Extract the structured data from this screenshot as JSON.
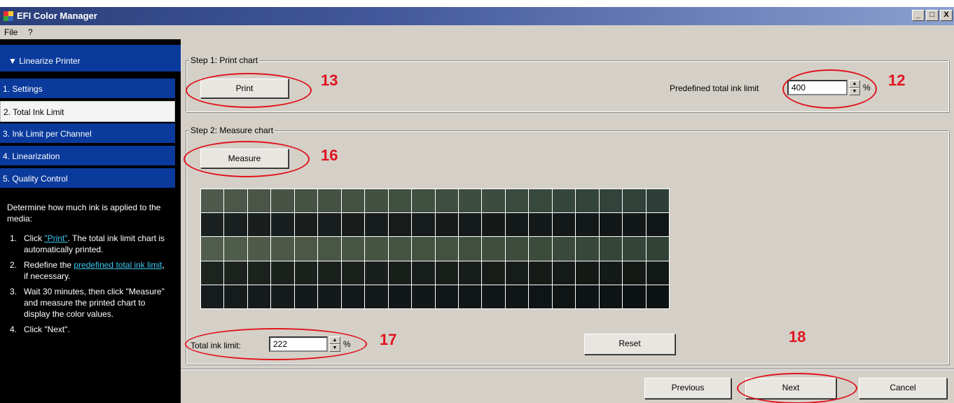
{
  "window": {
    "title": "EFI Color Manager",
    "minimize": "_",
    "maximize": "□",
    "close": "X"
  },
  "menu": [
    "File",
    "?"
  ],
  "sidebar": {
    "header": "Linearize Printer",
    "items": [
      {
        "label": "1. Settings"
      },
      {
        "label": "2. Total Ink Limit"
      },
      {
        "label": "3. Ink Limit per Channel"
      },
      {
        "label": "4. Linearization"
      },
      {
        "label": "5. Quality Control"
      }
    ],
    "help": {
      "intro": "Determine how much ink is applied to the media:",
      "steps": [
        {
          "num": "1.",
          "link": "\"Print\"",
          "text": ". The total ink limit chart is automatically printed.",
          "prefix": "Click "
        },
        {
          "num": "2.",
          "prefix": "Redefine the ",
          "link": "predefined total ink limit",
          "text": ", if necessary."
        },
        {
          "num": "3.",
          "text": "Wait 30 minutes, then click \"Measure\" and measure the printed chart to display the color values."
        },
        {
          "num": "4.",
          "text": "Click \"Next\"."
        }
      ]
    }
  },
  "step1": {
    "label": "Step 1: Print chart",
    "print_button": "Print",
    "ink_limit_label": "Predefined total ink limit",
    "ink_limit_value": "400",
    "unit": "%"
  },
  "step2": {
    "label": "Step 2: Measure chart",
    "measure_button": "Measure",
    "total_ink_label": "Total ink limit:",
    "total_ink_value": "222",
    "unit": "%",
    "reset_button": "Reset",
    "swatch_rows": [
      [
        "#4f5a4d",
        "#4c5749",
        "#4a5447",
        "#485345",
        "#465243",
        "#455243",
        "#445142",
        "#425041",
        "#405040",
        "#3f4f40",
        "#3e4e40",
        "#3d4d40",
        "#3b4b3f",
        "#394a3e",
        "#37483d",
        "#35463c",
        "#33443b",
        "#31433a",
        "#2f4139",
        "#2d3f38"
      ],
      [
        "#1b2120",
        "#1a201f",
        "#1a1f1e",
        "#191f1e",
        "#191e1d",
        "#181e1d",
        "#181d1c",
        "#171d1c",
        "#171c1b",
        "#161c1b",
        "#161b1a",
        "#151b1a",
        "#151a19",
        "#141a19",
        "#141919",
        "#131918",
        "#131818",
        "#121817",
        "#121717",
        "#111716"
      ],
      [
        "#525e4d",
        "#505c4a",
        "#4f5b48",
        "#4d5946",
        "#4c5845",
        "#4a5644",
        "#485543",
        "#475442",
        "#455341",
        "#445240",
        "#43513f",
        "#41503e",
        "#3f4e3e",
        "#3d4c3d",
        "#3b4b3c",
        "#39493b",
        "#37483a",
        "#354639",
        "#334438",
        "#314237"
      ],
      [
        "#1d2420",
        "#1c231f",
        "#1c221e",
        "#1b221e",
        "#1b211d",
        "#1a211d",
        "#1a201c",
        "#191f1c",
        "#191f1b",
        "#181e1b",
        "#181e1a",
        "#171d1a",
        "#171c19",
        "#161c19",
        "#161b18",
        "#151b18",
        "#151a17",
        "#141a17",
        "#141916",
        "#131916"
      ],
      [
        "#161c1d",
        "#161b1c",
        "#151b1c",
        "#151a1b",
        "#141a1b",
        "#14191a",
        "#13191a",
        "#131819",
        "#121819",
        "#121718",
        "#111718",
        "#111617",
        "#101617",
        "#101516",
        "#0f1516",
        "#0f1415",
        "#0e1415",
        "#0e1314",
        "#0d1314",
        "#0d1213"
      ]
    ]
  },
  "nav": {
    "previous": "Previous",
    "next": "Next",
    "cancel": "Cancel"
  },
  "annotations": {
    "a12": "12",
    "a13": "13",
    "a16": "16",
    "a17": "17",
    "a18": "18"
  },
  "colors": {
    "sidebar_blue": "#0a3a9c",
    "annotation_red": "#e0141e",
    "dialog_gray": "#d4d0c8"
  }
}
